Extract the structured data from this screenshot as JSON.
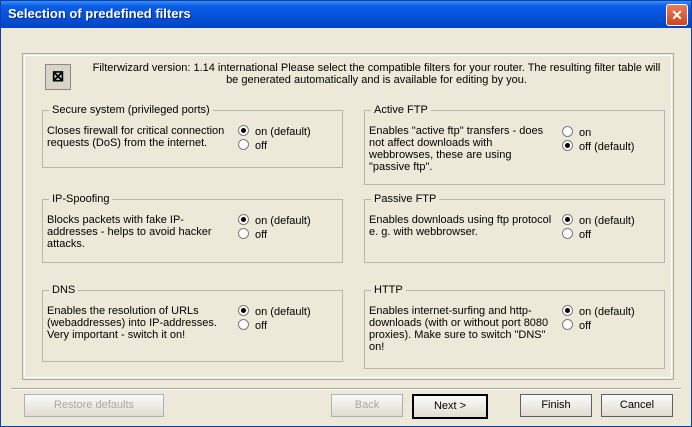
{
  "window": {
    "title": "Selection of predefined filters"
  },
  "intro": {
    "text": "Filterwizard version: 1.14 international Please select the compatible filters for your router. The resulting filter table will be generated automatically and is available for editing by you."
  },
  "groups": {
    "secure": {
      "title": "Secure system  (privileged ports)",
      "description": "Closes firewall for critical connection requests (DoS) from the internet.",
      "on": "on (default)",
      "off": "off",
      "selected": "on"
    },
    "ipspoof": {
      "title": "IP-Spoofing",
      "description": "Blocks packets with fake IP-addresses - helps to avoid hacker attacks.",
      "on": "on (default)",
      "off": "off",
      "selected": "on"
    },
    "dns": {
      "title": "DNS",
      "description": "Enables the resolution of URLs (webaddresses) into IP-addresses. Very important - switch it on!",
      "on": "on (default)",
      "off": "off",
      "selected": "on"
    },
    "activeftp": {
      "title": "Active FTP",
      "description": "Enables \"active ftp\" transfers - does not affect downloads with webbrowses, these are using \"passive ftp\".",
      "on": "on",
      "off": "off (default)",
      "selected": "off"
    },
    "passiveftp": {
      "title": "Passive FTP",
      "description": "Enables downloads using ftp protocol e. g. with webbrowser.",
      "on": "on (default)",
      "off": "off",
      "selected": "on"
    },
    "http": {
      "title": "HTTP",
      "description": "Enables internet-surfing and http-downloads (with or without port 8080 proxies). Make sure to switch \"DNS\" on!",
      "on": "on (default)",
      "off": "off",
      "selected": "on"
    }
  },
  "buttons": {
    "left_disabled": "Restore defaults",
    "back": "Back",
    "next": "Next >",
    "finish": "Finish",
    "cancel": "Cancel"
  }
}
